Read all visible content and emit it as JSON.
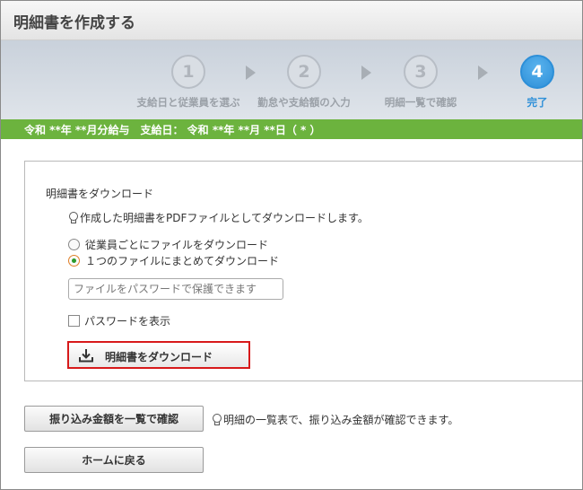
{
  "title": "明細書を作成する",
  "steps": [
    {
      "number": "1",
      "label": "支給日と従業員を選ぶ"
    },
    {
      "number": "2",
      "label": "勤怠や支給額の入力"
    },
    {
      "number": "3",
      "label": "明細一覧で確認"
    },
    {
      "number": "4",
      "label": "完了"
    }
  ],
  "info_bar": "令和 **年 **月分給与　支給日： 令和 **年 **月 **日（ * ）",
  "download": {
    "heading": "明細書をダウンロード",
    "hint": "作成した明細書をPDFファイルとしてダウンロードします。",
    "options": [
      "従業員ごとにファイルをダウンロード",
      "１つのファイルにまとめてダウンロード"
    ],
    "selected_option": "１つのファイルにまとめてダウンロード",
    "password_placeholder": "ファイルをパスワードで保護できます",
    "show_password_label": "パスワードを表示",
    "button_label": "明細書をダウンロード",
    "button_icon": "download-icon"
  },
  "transfer": {
    "button_label": "振り込み金額を一覧で確認",
    "hint": "明細の一覧表で、振り込み金額が確認できます。"
  },
  "home_button_label": "ホームに戻る",
  "colors": {
    "accent_blue": "#2d8fd8",
    "info_bar_green": "#6cb33e",
    "highlight_red": "#d7191a"
  }
}
